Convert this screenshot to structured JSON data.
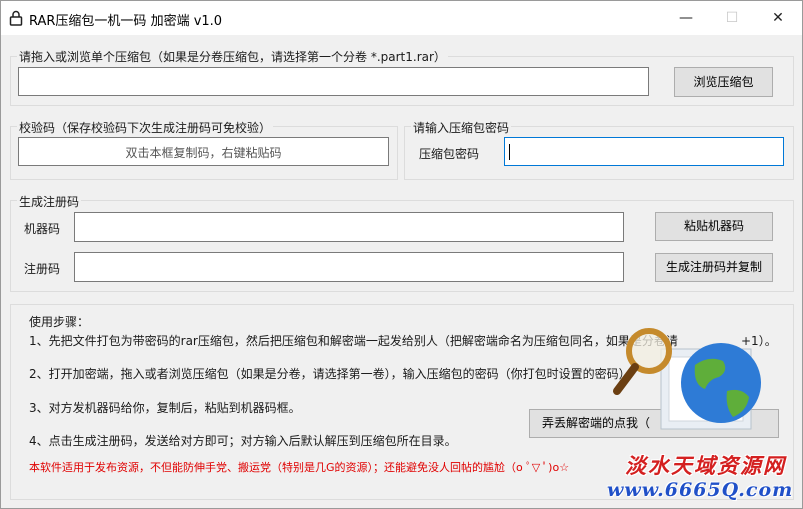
{
  "window": {
    "title": "RAR压缩包一机一码  加密端 v1.0",
    "controls": {
      "minimize": "—",
      "maximize": "☐",
      "close": "✕"
    }
  },
  "file_section": {
    "label": "请拖入或浏览单个压缩包（如果是分卷压缩包，请选择第一个分卷 *.part1.rar）",
    "path_value": "",
    "browse_button": "浏览压缩包"
  },
  "verify_section": {
    "label": "校验码（保存校验码下次生成注册码可免校验）",
    "hint": "双击本框复制码，右键粘贴码"
  },
  "password_section": {
    "label": "请输入压缩包密码",
    "field_label": "压缩包密码",
    "value": ""
  },
  "register_section": {
    "label": "生成注册码",
    "machine_label": "机器码",
    "machine_value": "",
    "paste_button": "粘贴机器码",
    "regcode_label": "注册码",
    "regcode_value": "",
    "generate_button": "生成注册码并复制"
  },
  "steps": {
    "title": "使用步骤：",
    "step1": "1、先把文件打包为带密码的rar压缩包，然后把压缩包和解密端一起发给别人（把解密端命名为压缩包同名，如果是分卷请",
    "step1_tail": "+1）。",
    "step2": "2、打开加密端，拖入或者浏览压缩包（如果是分卷，请选择第一卷），输入压缩包的密码（你打包时设置的密码）。",
    "step3": "3、对方发机器码给你，复制后，粘贴到机器码框。",
    "step4": "4、点击生成注册码，发送给对方即可；对方输入后默认解压到压缩包所在目录。",
    "warning": "本软件适用于发布资源，不但能防伸手党、搬运党（特别是几G的资源）；还能避免没人回帖的尴尬（o ﾟ▽ ﾟ)o☆",
    "decrypt_button": "弄丢解密端的点我（"
  },
  "watermark": {
    "line1": "淡水天域资源网",
    "line2": "www.6665Q.com"
  },
  "colors": {
    "accent": "#0078d7",
    "warning": "#e00000"
  }
}
